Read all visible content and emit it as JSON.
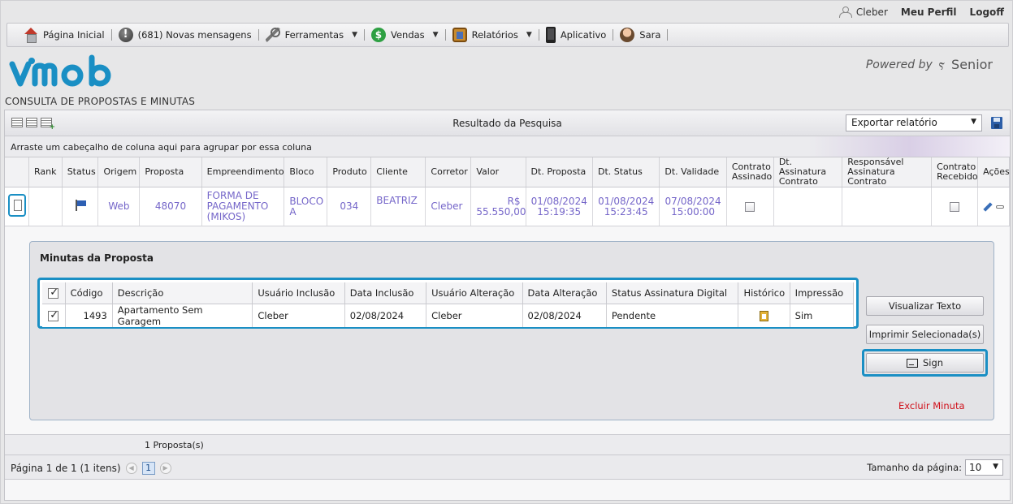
{
  "userbar": {
    "user": "Cleber",
    "profile": "Meu Perfil",
    "logoff": "Logoff"
  },
  "menu": {
    "home": "Página Inicial",
    "messages": "(681) Novas mensagens",
    "tools": "Ferramentas",
    "sales": "Vendas",
    "reports": "Relatórios",
    "app": "Aplicativo",
    "assistant": "Sara"
  },
  "brand": {
    "logo_text": "vimob",
    "powered_by": "Powered by",
    "partner": "Senior",
    "accent": "#1a8fc4"
  },
  "page_title": "CONSULTA DE PROPOSTAS E MINUTAS",
  "grid": {
    "title": "Resultado da Pesquisa",
    "export_label": "Exportar relatório",
    "group_hint": "Arraste um cabeçalho de coluna aqui para agrupar por essa coluna",
    "columns": [
      "Rank",
      "Status",
      "Origem",
      "Proposta",
      "Empreendimento",
      "Bloco",
      "Produto",
      "Cliente",
      "Corretor",
      "Valor",
      "Dt. Proposta",
      "Dt. Status",
      "Dt. Validade",
      "Contrato Assinado",
      "Dt. Assinatura Contrato",
      "Responsável Assinatura Contrato",
      "Contrato Recebido",
      "Ações"
    ],
    "row": {
      "origem": "Web",
      "proposta": "48070",
      "empreendimento": "FORMA DE PAGAMENTO (MIKOS)",
      "bloco": "BLOCO A",
      "produto": "034",
      "cliente": "BEATRIZ",
      "corretor": "Cleber",
      "valor": "R$ 55.550,00",
      "dt_proposta": "01/08/2024 15:19:35",
      "dt_status": "01/08/2024 15:23:45",
      "dt_validade": "07/08/2024 15:00:00"
    },
    "count": "1 Proposta(s)",
    "pager_text": "Página 1 de 1 (1 itens)",
    "current_page": "1",
    "page_size_label": "Tamanho da página:",
    "page_size": "10"
  },
  "minutas": {
    "title": "Minutas da Proposta",
    "columns": [
      "Código",
      "Descrição",
      "Usuário Inclusão",
      "Data Inclusão",
      "Usuário Alteração",
      "Data Alteração",
      "Status Assinatura Digital",
      "Histórico",
      "Impressão"
    ],
    "row": {
      "codigo": "1493",
      "descricao": "Apartamento Sem Garagem",
      "usuario_inclusao": "Cleber",
      "data_inclusao": "02/08/2024",
      "usuario_alteracao": "Cleber",
      "data_alteracao": "02/08/2024",
      "status": "Pendente",
      "impressao": "Sim"
    },
    "buttons": {
      "view_text": "Visualizar Texto",
      "print_selected": "Imprimir Selecionada(s)",
      "sign": "Sign",
      "delete": "Excluir Minuta"
    }
  }
}
